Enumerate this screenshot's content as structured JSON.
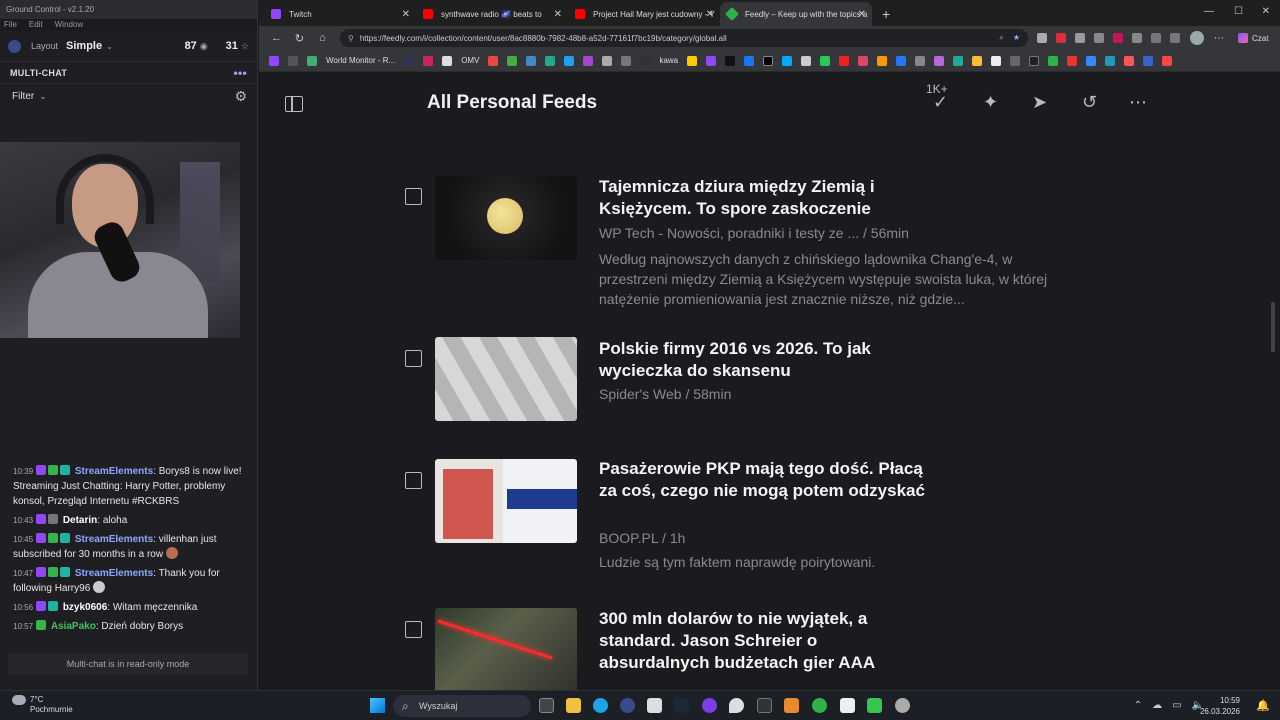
{
  "ground_control": {
    "title": "Ground Control - v2.1.20",
    "menu": [
      "File",
      "Edit",
      "Window"
    ],
    "layout_label": "Layout",
    "layout_value": "Simple",
    "viewer_count": "87",
    "second_count": "31",
    "multichat_title": "MULTI-CHAT",
    "filter_label": "Filter",
    "readonly_notice": "Multi-chat is in read-only mode",
    "chat": [
      {
        "time": "10:39",
        "user": "StreamElements",
        "text": "Borys8 is now live! Streaming Just Chatting: Harry Potter, problemy konsol, Przegląd Internetu #RCKBRS"
      },
      {
        "time": "10:43",
        "user": "Detarin",
        "text": "aloha"
      },
      {
        "time": "10:45",
        "user": "StreamElements",
        "text": "villenhan just subscribed for 30 months in a row"
      },
      {
        "time": "10:47",
        "user": "StreamElements",
        "text": "Thank you for following Harry96"
      },
      {
        "time": "10:56",
        "user": "bzyk0606",
        "text": "Witam męczennika"
      },
      {
        "time": "10:57",
        "user": "AsiaPako",
        "text": "Dzień dobry Borys"
      }
    ]
  },
  "browser": {
    "tabs": [
      {
        "label": "Twitch",
        "color": "#9147ff"
      },
      {
        "label": "synthwave radio 🌌 beats to",
        "color": "#ff0000"
      },
      {
        "label": "Project Hail Mary jest cudowny - Y",
        "color": "#ff0000"
      },
      {
        "label": "Feedly – Keep up with the topics a",
        "color": "#2bb24c"
      }
    ],
    "url": "https://feedly.com/i/collection/content/user/8ac8880b-7982-48b8-a52d-77161f7bc19b/category/global.all",
    "chat_button": "Czat",
    "bookmarks": [
      "World Monitor - R...",
      "OMV",
      "kawa"
    ]
  },
  "feedly": {
    "title": "All Personal Feeds",
    "mark_read_count": "1K+",
    "articles": [
      {
        "title": "Tajemnicza dziura między Ziemią i Księżycem. To spore zaskoczenie",
        "source": "WP Tech - Nowości, poradniki i testy ze ... / 56min",
        "summary": "Według najnowszych danych z chińskiego lądownika Chang'e-4, w przestrzeni między Ziemią a Księżycem występuje swoista luka, w której natężenie promieniowania jest znacznie niższe, niż gdzie..."
      },
      {
        "title": "Polskie firmy 2016 vs 2026. To jak wycieczka do skansenu",
        "source": "Spider's Web / 58min",
        "summary": ""
      },
      {
        "title": "Pasażerowie PKP mają tego dość. Płacą za coś, czego nie mogą potem odzyskać",
        "source": "BOOP.PL / 1h",
        "summary": "Ludzie są tym faktem naprawdę poirytowani."
      },
      {
        "title": "300 mln dolarów to nie wyjątek, a standard. Jason Schreier o absurdalnych budżetach gier AAA",
        "source": "",
        "summary": ""
      }
    ]
  },
  "taskbar": {
    "temperature": "7°C",
    "condition": "Pochmurnie",
    "search_placeholder": "Wyszukaj",
    "time": "10:59",
    "date": "26.03.2026"
  }
}
